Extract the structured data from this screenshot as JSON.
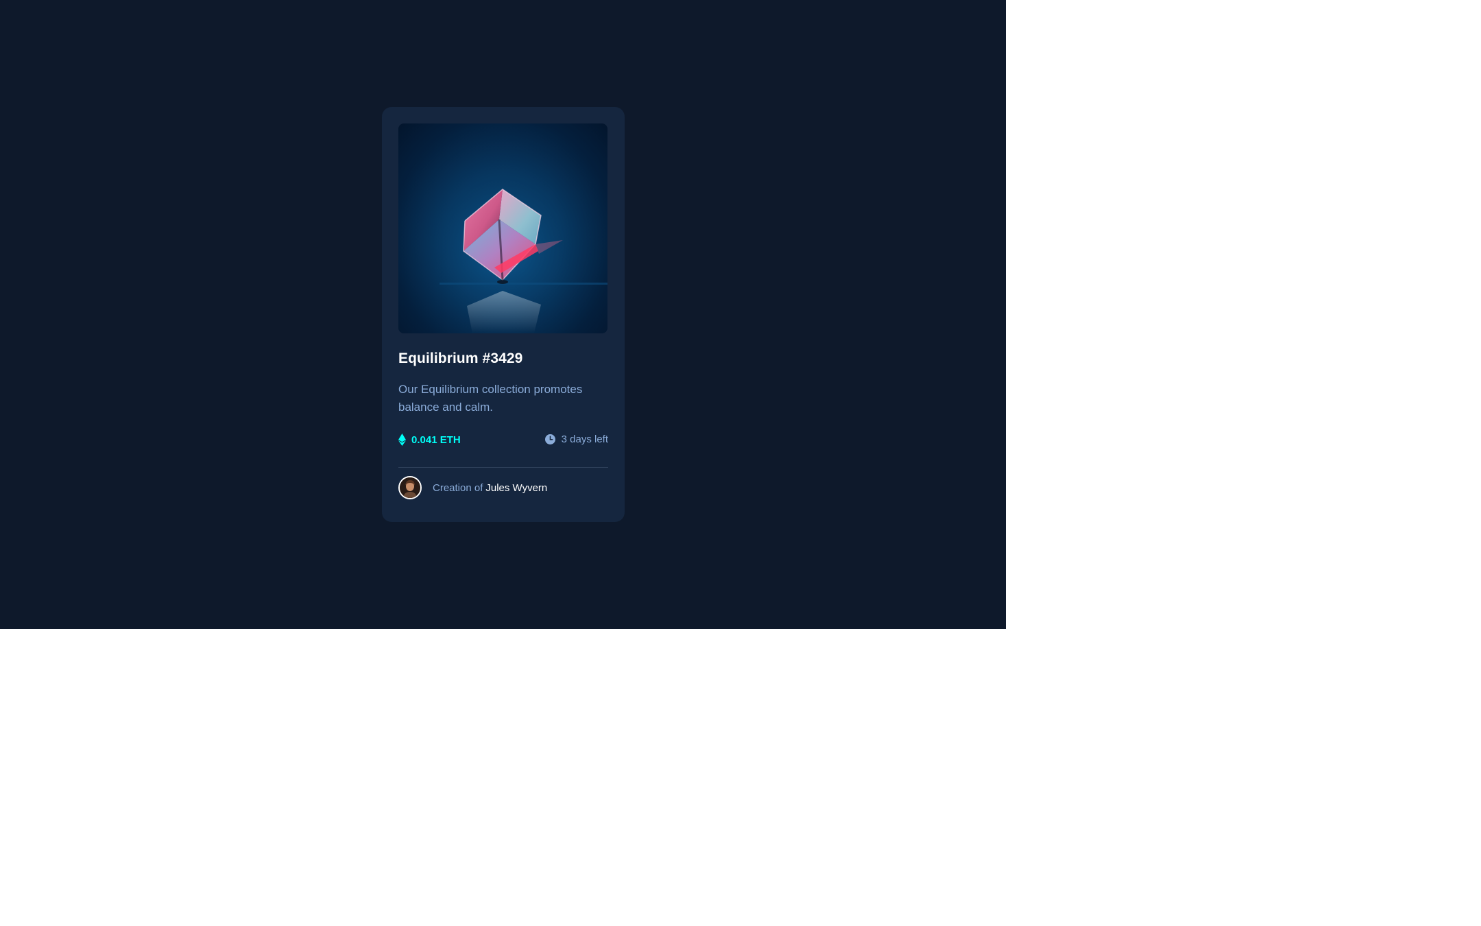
{
  "card": {
    "title": "Equilibrium #3429",
    "description": "Our Equilibrium collection promotes balance and calm.",
    "price": "0.041 ETH",
    "time_left": "3 days left",
    "creator_prefix": "Creation of",
    "creator_name": "Jules Wyvern"
  },
  "icons": {
    "price": "ethereum-icon",
    "time": "clock-icon"
  },
  "colors": {
    "page_background": "#0e192b",
    "card_background": "#15263f",
    "accent_cyan": "#00fff8",
    "soft_blue": "#8bacd9",
    "white": "#ffffff",
    "divider": "#2e405a"
  }
}
